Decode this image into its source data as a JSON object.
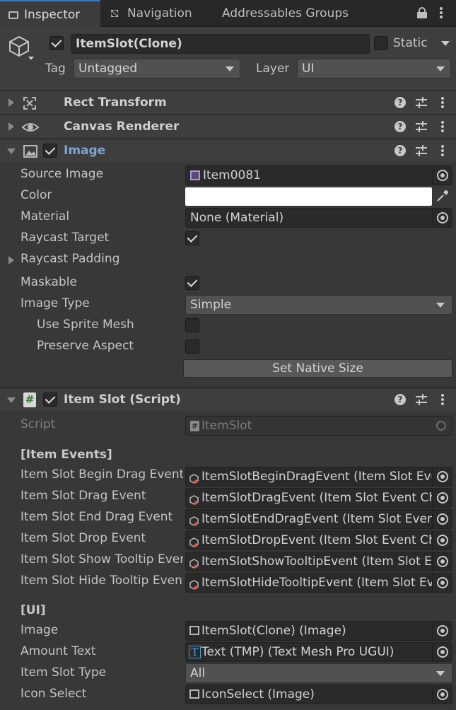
{
  "tabs": [
    "Inspector",
    "Navigation",
    "Addressables Groups"
  ],
  "object": {
    "name": "ItemSlot(Clone)",
    "static_label": "Static",
    "tag_label": "Tag",
    "tag_value": "Untagged",
    "layer_label": "Layer",
    "layer_value": "UI"
  },
  "components": {
    "rect_transform": "Rect Transform",
    "canvas_renderer": "Canvas Renderer",
    "image": "Image",
    "item_slot": "Item Slot (Script)"
  },
  "image": {
    "source_image_label": "Source Image",
    "source_image_value": "Item0081",
    "color_label": "Color",
    "color_value": "#ffffff",
    "material_label": "Material",
    "material_value": "None (Material)",
    "raycast_target_label": "Raycast Target",
    "raycast_padding_label": "Raycast Padding",
    "maskable_label": "Maskable",
    "image_type_label": "Image Type",
    "image_type_value": "Simple",
    "use_sprite_mesh_label": "Use Sprite Mesh",
    "preserve_aspect_label": "Preserve Aspect",
    "set_native_size": "Set Native Size"
  },
  "item_slot": {
    "script_label": "Script",
    "script_value": "ItemSlot",
    "events_header": "[Item Events]",
    "events": [
      {
        "label": "Item Slot Begin Drag Event",
        "value": "ItemSlotBeginDragEvent (Item Slot Event Channel)"
      },
      {
        "label": "Item Slot Drag Event",
        "value": "ItemSlotDragEvent (Item Slot Event Channel)"
      },
      {
        "label": "Item Slot End Drag Event",
        "value": "ItemSlotEndDragEvent (Item Slot Event Channel)"
      },
      {
        "label": "Item Slot Drop Event",
        "value": "ItemSlotDropEvent (Item Slot Event Channel)"
      },
      {
        "label": "Item Slot Show Tooltip Event",
        "value": "ItemSlotShowTooltipEvent (Item Slot Event Channel)"
      },
      {
        "label": "Item Slot Hide Tooltip Event",
        "value": "ItemSlotHideTooltipEvent (Item Slot Event Channel)"
      }
    ],
    "ui_header": "[UI]",
    "image_label": "Image",
    "image_value": "ItemSlot(Clone) (Image)",
    "amount_text_label": "Amount Text",
    "amount_text_value": "Text (TMP) (Text Mesh Pro UGUI)",
    "item_slot_type_label": "Item Slot Type",
    "item_slot_type_value": "All",
    "icon_select_label": "Icon Select",
    "icon_select_value": "IconSelect (Image)"
  },
  "colors": {
    "accent": "#3a79bb",
    "image_title": "#7fa5d6"
  }
}
